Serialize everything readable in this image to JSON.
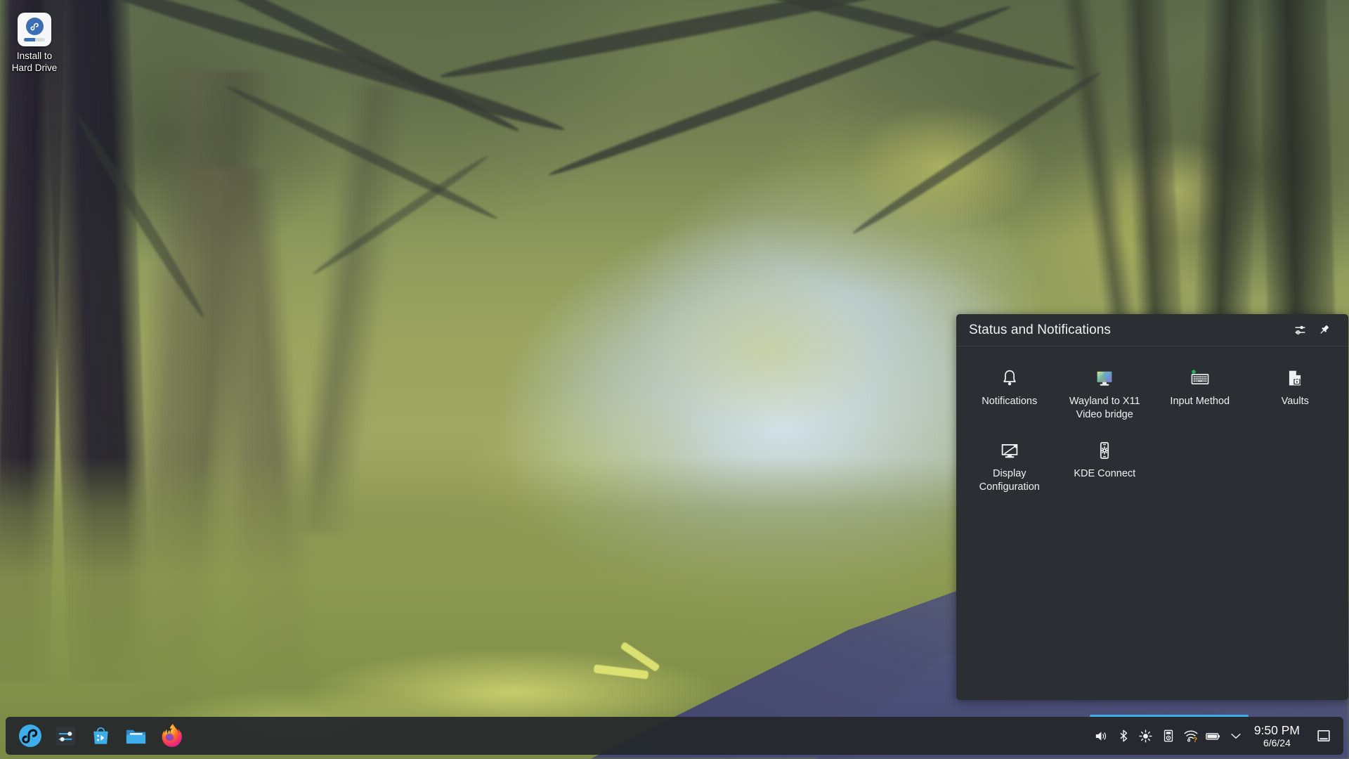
{
  "desktop": {
    "icons": [
      {
        "name": "install-to-hard-drive",
        "label": "Install to\nHard Drive",
        "label_line1": "Install to",
        "label_line2": "Hard Drive",
        "icon": "fedora-installer-icon"
      }
    ],
    "wallpaper_name": "KDE Plasma painted forest path",
    "wallpaper_colors": {
      "sky": "#c6d8e8",
      "canopy_green": "#8f9a5c",
      "canopy_highlight": "#d4d66e",
      "trunk_dark": "#262230",
      "grass": "#8e9a50",
      "path_blue": "#4a4e76"
    }
  },
  "popup": {
    "title": "Status and Notifications",
    "header_buttons": [
      {
        "name": "configure-button",
        "icon": "sliders-icon",
        "tooltip": "Configure"
      },
      {
        "name": "pin-button",
        "icon": "pin-icon",
        "tooltip": "Keep Open"
      }
    ],
    "items": [
      {
        "label": "Notifications",
        "icon": "bell-icon",
        "badge": null
      },
      {
        "label": "Wayland to X11 Video bridge",
        "label_line1": "Wayland to X11",
        "label_line2": "Video bridge",
        "icon": "monitor-color-icon",
        "badge": null
      },
      {
        "label": "Input Method",
        "icon": "keyboard-icon",
        "badge": "green-dot"
      },
      {
        "label": "Vaults",
        "icon": "vault-lock-icon",
        "badge": null
      },
      {
        "label": "Display Configuration",
        "label_line1": "Display",
        "label_line2": "Configuration",
        "icon": "display-icon",
        "badge": null
      },
      {
        "label": "KDE Connect",
        "icon": "kde-connect-phone-icon",
        "badge": null
      }
    ],
    "background_color": "#2b2f33"
  },
  "taskbar": {
    "launchers": [
      {
        "name": "application-launcher",
        "label": "Application Launcher",
        "icon": "fedora-logo-icon"
      },
      {
        "name": "system-settings",
        "label": "System Settings",
        "icon": "sliders-settings-icon"
      },
      {
        "name": "discover",
        "label": "Discover",
        "icon": "discover-bag-icon"
      },
      {
        "name": "dolphin",
        "label": "Dolphin File Manager",
        "icon": "folder-icon"
      },
      {
        "name": "firefox",
        "label": "Firefox",
        "icon": "firefox-icon"
      }
    ],
    "systray": [
      {
        "name": "volume",
        "label": "Audio Volume",
        "icon": "speaker-icon"
      },
      {
        "name": "bluetooth",
        "label": "Bluetooth",
        "icon": "bluetooth-icon"
      },
      {
        "name": "brightness",
        "label": "Brightness and Color",
        "icon": "sun-icon"
      },
      {
        "name": "media-player",
        "label": "Media Player",
        "icon": "media-player-icon"
      },
      {
        "name": "networks",
        "label": "Networks",
        "icon": "wifi-unknown-icon",
        "badge": "question-mark"
      },
      {
        "name": "battery",
        "label": "Battery and Brightness",
        "icon": "battery-icon"
      },
      {
        "name": "expand-tray",
        "label": "Show hidden icons",
        "icon": "chevron-down-icon"
      }
    ],
    "clock": {
      "time": "9:50 PM",
      "date": "6/6/24"
    },
    "show_desktop": {
      "name": "peek-at-desktop",
      "label": "Peek at Desktop",
      "icon": "desktop-peek-icon"
    },
    "highlight_color": "#3daee9",
    "background_color": "#23272b"
  }
}
